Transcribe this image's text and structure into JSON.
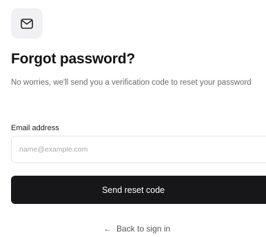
{
  "header": {
    "icon": "mail-icon",
    "title": "Forgot password?",
    "subtitle": "No worries, we'll send you a verification code to reset your password"
  },
  "form": {
    "email_label": "Email address",
    "email_placeholder": "name@example.com",
    "email_value": "",
    "submit_label": "Send reset code"
  },
  "footer": {
    "back_icon": "arrow-left-icon",
    "back_label": "Back to sign in"
  },
  "colors": {
    "primary_button": "#17171a",
    "icon_background": "#f1f1f3",
    "muted_text": "#6b6b6b"
  }
}
